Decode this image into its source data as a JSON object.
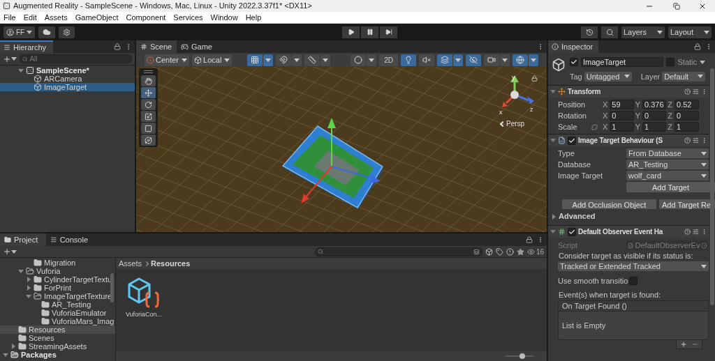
{
  "window": {
    "title": "Augmented Reality - SampleScene - Windows, Mac, Linux - Unity 2022.3.37f1* <DX11>"
  },
  "menu": [
    "File",
    "Edit",
    "Assets",
    "GameObject",
    "Component",
    "Services",
    "Window",
    "Help"
  ],
  "toolbar": {
    "account": "FF",
    "layers": "Layers",
    "layout": "Layout"
  },
  "hierarchy": {
    "title": "Hierarchy",
    "search_placeholder": "All",
    "items": [
      {
        "label": "SampleScene*",
        "kind": "scene",
        "expanded": true,
        "selected": false,
        "children": [
          {
            "label": "ARCamera",
            "kind": "object",
            "selected": false
          },
          {
            "label": "ImageTarget",
            "kind": "object",
            "selected": true
          }
        ]
      }
    ]
  },
  "scene": {
    "tabs": [
      {
        "label": "Scene",
        "selected": true
      },
      {
        "label": "Game",
        "selected": false
      }
    ],
    "pivot": "Center",
    "space": "Local",
    "left_buttons": [
      {
        "kind": "gridsnap",
        "on": true
      },
      {
        "kind": "increment",
        "on": false
      },
      {
        "kind": "grid",
        "on": false
      }
    ],
    "right_buttons": [
      {
        "kind": "shading",
        "on": false
      },
      {
        "kind": "dimension",
        "label": "2D",
        "on": false
      },
      {
        "kind": "lighting",
        "on": true
      },
      {
        "kind": "audio",
        "on": false
      },
      {
        "kind": "effects",
        "on": true
      },
      {
        "kind": "visibility",
        "on": true
      },
      {
        "kind": "camera",
        "on": false
      },
      {
        "kind": "gizmos",
        "on": true
      }
    ],
    "tools": [
      {
        "kind": "hand",
        "selected": false
      },
      {
        "kind": "move",
        "selected": true
      },
      {
        "kind": "rotate",
        "selected": false
      },
      {
        "kind": "scale",
        "selected": false
      },
      {
        "kind": "rect",
        "selected": false
      },
      {
        "kind": "transform",
        "selected": false
      }
    ],
    "gizmo": {
      "y": "y",
      "x": "x",
      "z": "z",
      "projection": "Persp"
    }
  },
  "inspector": {
    "title": "Inspector",
    "object": {
      "enabled": true,
      "name": "ImageTarget",
      "static": false,
      "static_label": "Static",
      "tag_label": "Tag",
      "tag": "Untagged",
      "layer_label": "Layer",
      "layer": "Default"
    },
    "transform": {
      "title": "Transform",
      "rows": [
        {
          "label": "Position",
          "fields": [
            {
              "axis": "X",
              "value": "59"
            },
            {
              "axis": "Y",
              "value": "0.376"
            },
            {
              "axis": "Z",
              "value": "0.52"
            }
          ]
        },
        {
          "label": "Rotation",
          "fields": [
            {
              "axis": "X",
              "value": "0"
            },
            {
              "axis": "Y",
              "value": "0"
            },
            {
              "axis": "Z",
              "value": "0"
            }
          ]
        },
        {
          "label": "Scale",
          "linked": false,
          "fields": [
            {
              "axis": "X",
              "value": "1"
            },
            {
              "axis": "Y",
              "value": "1"
            },
            {
              "axis": "Z",
              "value": "1"
            }
          ]
        }
      ]
    },
    "behaviour": {
      "title": "Image Target Behaviour (S",
      "enabled": true,
      "props": [
        {
          "label": "Type",
          "value": "From Database"
        },
        {
          "label": "Database",
          "value": "AR_Testing"
        },
        {
          "label": "Image Target",
          "value": "wolf_card"
        }
      ],
      "add_target": "Add Target",
      "buttons": [
        "Add Occlusion Object",
        "Add Target Re"
      ],
      "advanced": "Advanced",
      "advanced_expanded": false
    },
    "observer": {
      "title": "Default Observer Event Ha",
      "enabled": true,
      "script_label": "Script",
      "script": "DefaultObserverEv",
      "consider_label": "Consider target as visible if its status is:",
      "status": "Tracked or Extended Tracked",
      "smooth_label": "Use smooth transitio",
      "smooth": false,
      "events_label": "Event(s) when target is found:",
      "event_header": "On Target Found ()",
      "event_empty": "List is Empty"
    }
  },
  "project": {
    "tabs": [
      {
        "label": "Project",
        "selected": true
      },
      {
        "label": "Console",
        "selected": false
      }
    ],
    "hidden_count": "16",
    "tree": [
      {
        "children": [
          {
            "children": [
              {
                "children": [
                  {
                    "label": "Migration",
                    "kind": "folder",
                    "selected": false
                  }
                ]
              },
              {
                "label": "Vuforia",
                "kind": "folder",
                "expanded": true,
                "selected": false,
                "children": [
                  {
                    "label": "CylinderTargetTextu",
                    "kind": "folder",
                    "expanded": false,
                    "selected": false
                  },
                  {
                    "label": "ForPrint",
                    "kind": "folder",
                    "expanded": false,
                    "selected": false
                  },
                  {
                    "label": "ImageTargetTexture",
                    "kind": "folder",
                    "expanded": true,
                    "selected": false,
                    "children": [
                      {
                        "label": "AR_Testing",
                        "kind": "folder",
                        "selected": false
                      },
                      {
                        "label": "VuforiaEmulator",
                        "kind": "folder",
                        "selected": false
                      },
                      {
                        "label": "VuforiaMars_Imag",
                        "kind": "folder",
                        "selected": false
                      }
                    ]
                  }
                ]
              }
            ]
          },
          {
            "label": "Resources",
            "kind": "folder",
            "selected": true
          },
          {
            "label": "Scenes",
            "kind": "folder",
            "selected": false
          },
          {
            "label": "StreamingAssets",
            "kind": "folder",
            "expanded": false,
            "selected": false
          }
        ]
      },
      {
        "label": "Packages",
        "kind": "root",
        "expanded": true,
        "selected": false
      }
    ],
    "breadcrumb": [
      "Assets",
      "Resources"
    ],
    "assets": [
      {
        "name": "VuforiaCon..."
      }
    ],
    "zoom": {
      "level": 0.6
    }
  }
}
